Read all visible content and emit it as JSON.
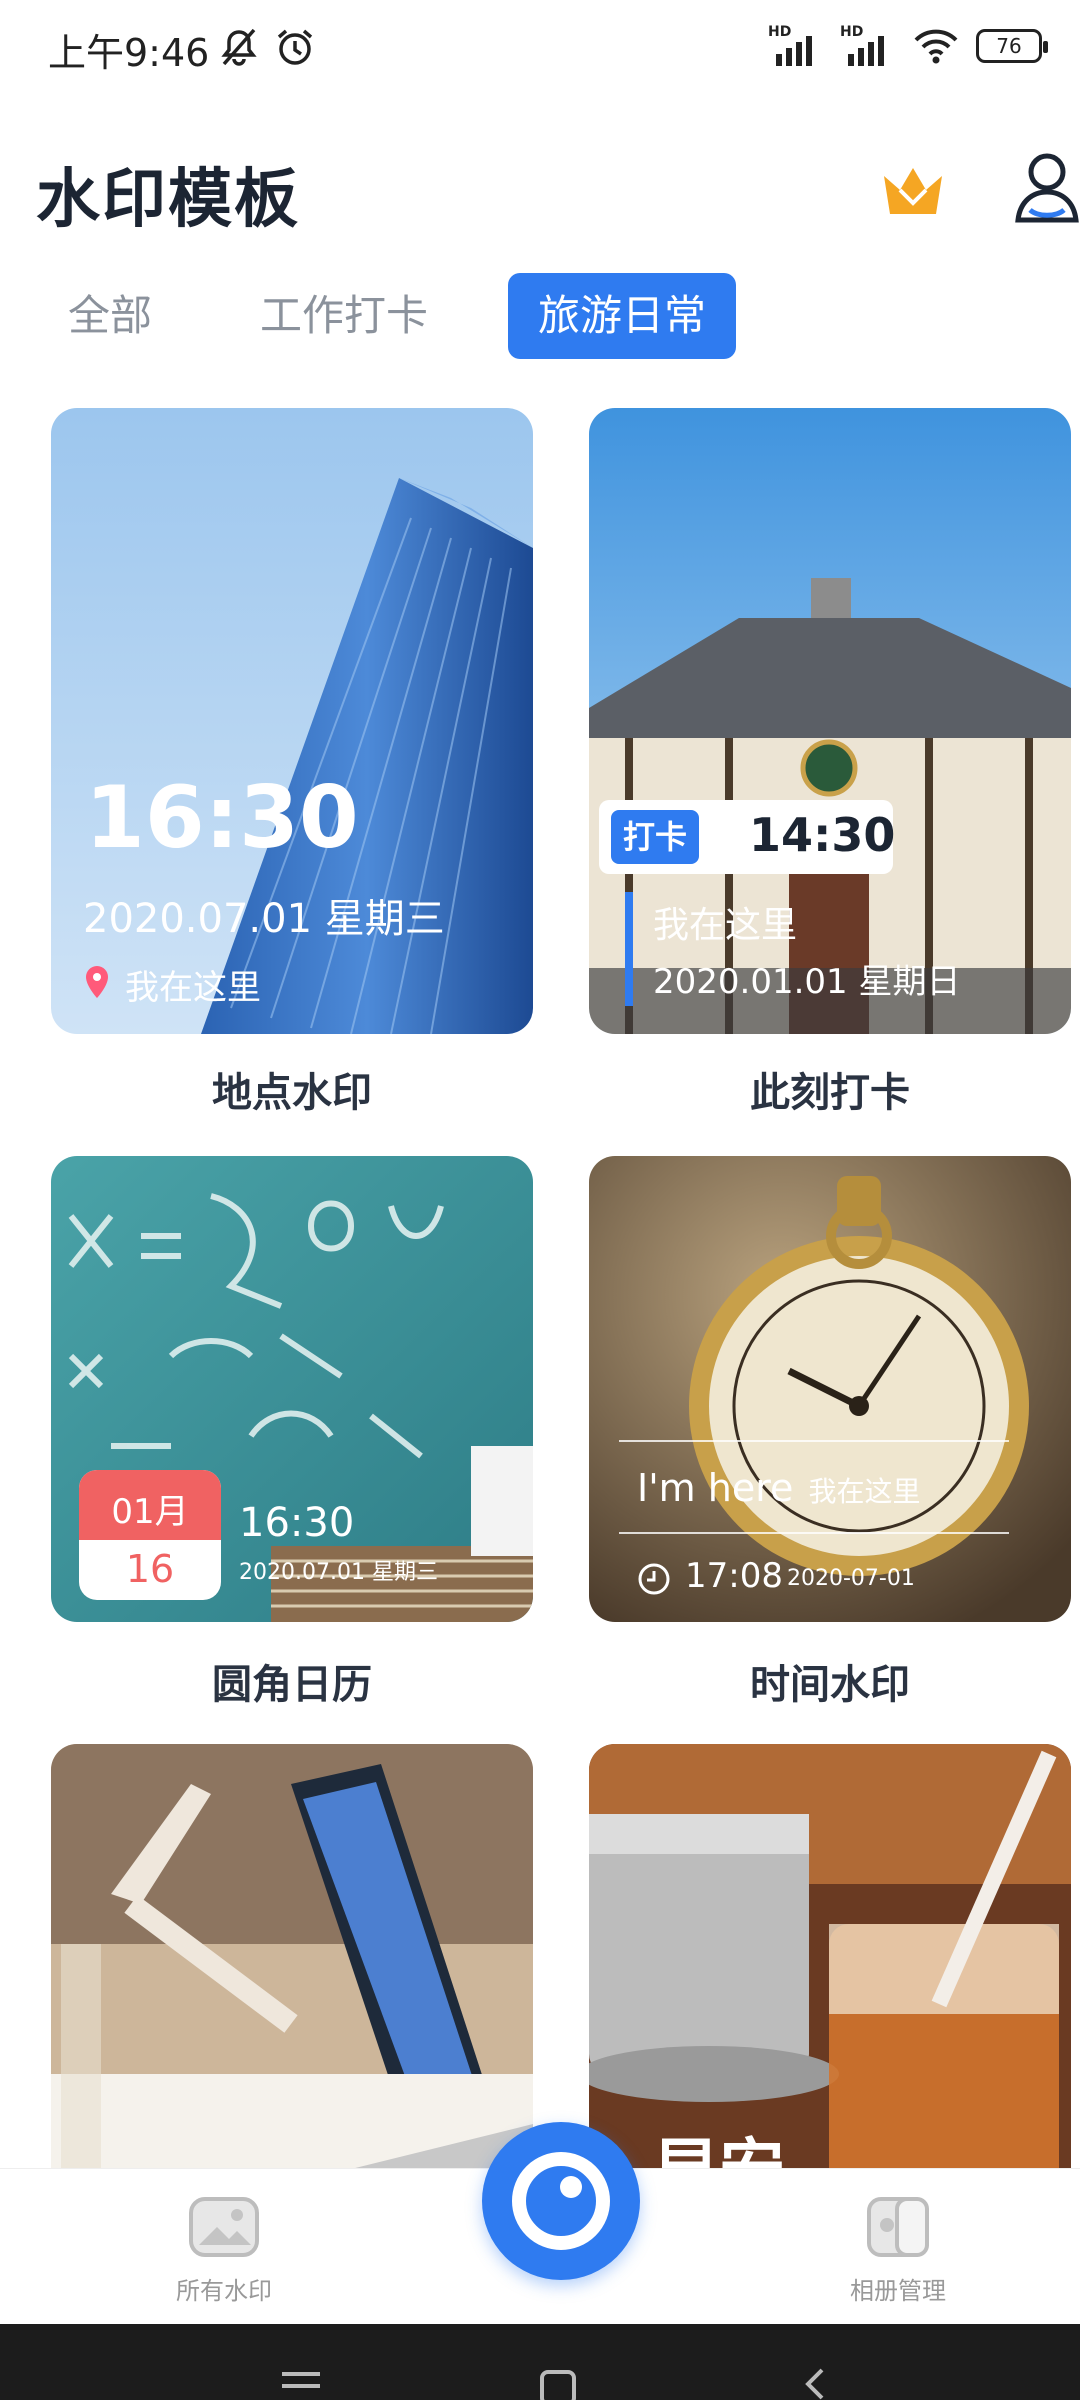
{
  "status_bar": {
    "time": "上午9:46",
    "battery": "76",
    "hd_label": "HD"
  },
  "header": {
    "title": "水印模板"
  },
  "tabs": [
    {
      "label": "全部",
      "active": false
    },
    {
      "label": "工作打卡",
      "active": false
    },
    {
      "label": "旅游日常",
      "active": true
    }
  ],
  "cards": [
    {
      "caption": "地点水印",
      "time": "16:30",
      "date": "2020.07.01 星期三",
      "place": "我在这里"
    },
    {
      "caption": "此刻打卡",
      "badge": "打卡",
      "time": "14:30",
      "place": "我在这里",
      "date": "2020.01.01  星期日"
    },
    {
      "caption": "圆角日历",
      "month": "01月",
      "day": "16",
      "time": "16:30",
      "date": "2020.07.01 星期三"
    },
    {
      "caption": "时间水印",
      "line1_en": "I'm here",
      "line1_cn": "我在这里",
      "time": "17:08",
      "date": "2020-07-01"
    },
    {
      "caption": ""
    },
    {
      "caption": "",
      "overlay_text": "早安"
    }
  ],
  "bottom_nav": {
    "left_label": "所有水印",
    "right_label": "相册管理"
  },
  "colors": {
    "accent": "#2f7bf0",
    "crown": "#f5a623",
    "calendar_red": "#f06262"
  }
}
